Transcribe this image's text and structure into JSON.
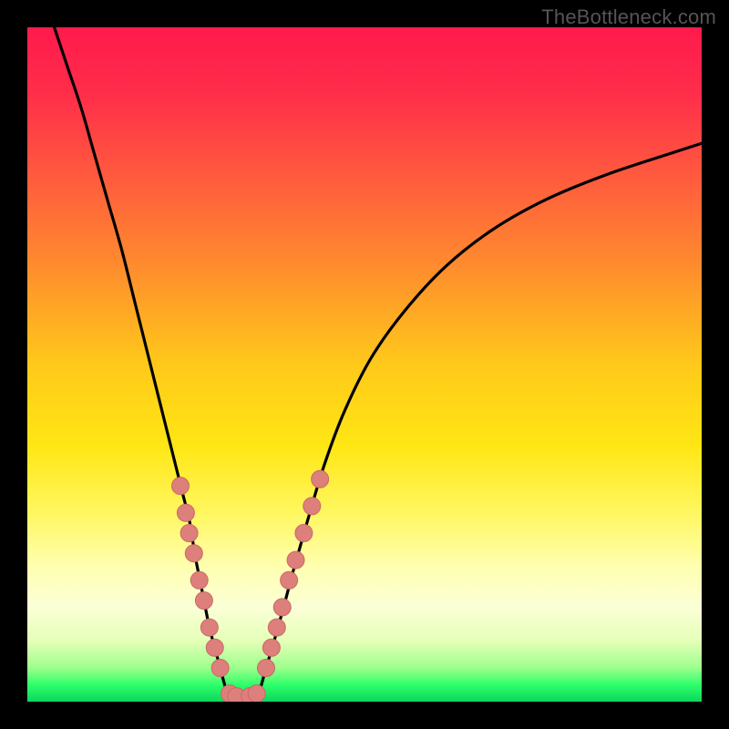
{
  "watermark": "TheBottleneck.com",
  "colors": {
    "black": "#000000",
    "curve": "#000000",
    "marker_fill": "#dd7f7b",
    "marker_stroke": "#c96a66",
    "gradient_stops": [
      {
        "offset": 0.0,
        "color": "#ff1a4d"
      },
      {
        "offset": 0.1,
        "color": "#ff2e4a"
      },
      {
        "offset": 0.22,
        "color": "#ff5a3e"
      },
      {
        "offset": 0.35,
        "color": "#ff8a2e"
      },
      {
        "offset": 0.5,
        "color": "#ffc91a"
      },
      {
        "offset": 0.62,
        "color": "#ffe614"
      },
      {
        "offset": 0.72,
        "color": "#fff760"
      },
      {
        "offset": 0.8,
        "color": "#ffffb0"
      },
      {
        "offset": 0.86,
        "color": "#fbffd6"
      },
      {
        "offset": 0.91,
        "color": "#e5ffb8"
      },
      {
        "offset": 0.95,
        "color": "#9cff8c"
      },
      {
        "offset": 0.975,
        "color": "#2eff6a"
      },
      {
        "offset": 1.0,
        "color": "#0bd65c"
      }
    ]
  },
  "chart_data": {
    "type": "line",
    "title": "",
    "xlabel": "",
    "ylabel": "",
    "xlim": [
      0,
      100
    ],
    "ylim": [
      0,
      100
    ],
    "series": [
      {
        "name": "left-branch",
        "x": [
          4,
          6,
          8,
          10,
          12,
          14,
          16,
          18,
          20,
          21,
          22,
          23,
          24,
          24.5,
          25,
          25.6,
          26.2,
          27,
          27.8,
          28.6,
          29.6
        ],
        "y": [
          100,
          94,
          88,
          81,
          74,
          67,
          59,
          51,
          43,
          39,
          35,
          31,
          27,
          24,
          21,
          18,
          15,
          11,
          8,
          5,
          1.5
        ]
      },
      {
        "name": "valley-floor",
        "x": [
          29.6,
          30.5,
          31.6,
          32.8,
          33.8,
          34.4
        ],
        "y": [
          1.5,
          0.8,
          0.6,
          0.6,
          0.8,
          1.5
        ]
      },
      {
        "name": "right-branch",
        "x": [
          34.4,
          35.4,
          36.6,
          38,
          39.6,
          41.6,
          44,
          47,
          51,
          56,
          62,
          69,
          77,
          86,
          96,
          100
        ],
        "y": [
          1.5,
          5,
          9,
          14,
          20,
          27,
          35,
          43,
          51,
          58,
          64.5,
          70,
          74.5,
          78.2,
          81.5,
          82.8
        ]
      }
    ],
    "markers": {
      "name": "highlight-points",
      "points": [
        {
          "x": 22.7,
          "y": 32
        },
        {
          "x": 23.5,
          "y": 28
        },
        {
          "x": 24.0,
          "y": 25
        },
        {
          "x": 24.7,
          "y": 22
        },
        {
          "x": 25.5,
          "y": 18
        },
        {
          "x": 26.2,
          "y": 15
        },
        {
          "x": 27.0,
          "y": 11
        },
        {
          "x": 27.8,
          "y": 8
        },
        {
          "x": 28.6,
          "y": 5
        },
        {
          "x": 30.0,
          "y": 1.2
        },
        {
          "x": 31.0,
          "y": 0.8
        },
        {
          "x": 33.0,
          "y": 0.8
        },
        {
          "x": 34.0,
          "y": 1.2
        },
        {
          "x": 35.4,
          "y": 5
        },
        {
          "x": 36.2,
          "y": 8
        },
        {
          "x": 37.0,
          "y": 11
        },
        {
          "x": 37.8,
          "y": 14
        },
        {
          "x": 38.8,
          "y": 18
        },
        {
          "x": 39.8,
          "y": 21
        },
        {
          "x": 41.0,
          "y": 25
        },
        {
          "x": 42.2,
          "y": 29
        },
        {
          "x": 43.4,
          "y": 33
        }
      ]
    }
  }
}
